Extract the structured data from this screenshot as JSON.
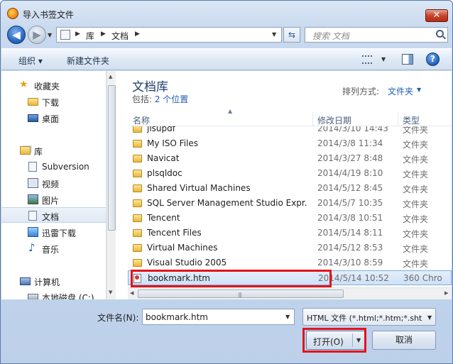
{
  "window": {
    "title": "导入书签文件",
    "close_label": "✕"
  },
  "navbar": {
    "breadcrumb": [
      "库",
      "文档"
    ],
    "search_placeholder": "搜索 文档"
  },
  "toolbar": {
    "organize_label": "组织 ▾",
    "new_folder_label": "新建文件夹",
    "help_label": "?"
  },
  "sidebar": {
    "items": [
      {
        "label": "收藏夹",
        "icon": "star-icon"
      },
      {
        "label": "下载",
        "icon": "folder-icon"
      },
      {
        "label": "桌面",
        "icon": "desktop-icon"
      },
      {
        "label": "库",
        "icon": "library-icon"
      },
      {
        "label": "Subversion",
        "icon": "document-icon"
      },
      {
        "label": "视频",
        "icon": "video-icon"
      },
      {
        "label": "图片",
        "icon": "picture-icon"
      },
      {
        "label": "文档",
        "icon": "document-icon"
      },
      {
        "label": "迅雷下载",
        "icon": "download-icon"
      },
      {
        "label": "音乐",
        "icon": "music-icon"
      },
      {
        "label": "计算机",
        "icon": "computer-icon"
      },
      {
        "label": "本地磁盘 (C:)",
        "icon": "disk-icon"
      }
    ],
    "selected": "文档"
  },
  "library": {
    "title": "文档库",
    "includes_label": "包括: ",
    "includes_link": "2 个位置",
    "arrange_label": "排列方式:",
    "arrange_value": "文件夹"
  },
  "columns": {
    "name": "名称",
    "date": "修改日期",
    "type": "类型"
  },
  "files": [
    {
      "name": "jisupdf",
      "date": "2014/3/10 14:43",
      "type": "文件夹"
    },
    {
      "name": "My ISO Files",
      "date": "2014/3/8 11:34",
      "type": "文件夹"
    },
    {
      "name": "Navicat",
      "date": "2014/3/27 8:48",
      "type": "文件夹"
    },
    {
      "name": "plsqldoc",
      "date": "2014/4/19 8:10",
      "type": "文件夹"
    },
    {
      "name": "Shared Virtual Machines",
      "date": "2014/5/12 8:45",
      "type": "文件夹"
    },
    {
      "name": "SQL Server Management Studio Expr...",
      "date": "2014/5/7 10:35",
      "type": "文件夹"
    },
    {
      "name": "Tencent",
      "date": "2014/3/8 10:51",
      "type": "文件夹"
    },
    {
      "name": "Tencent Files",
      "date": "2014/5/14 8:11",
      "type": "文件夹"
    },
    {
      "name": "Virtual Machines",
      "date": "2014/5/12 8:53",
      "type": "文件夹"
    },
    {
      "name": "Visual Studio 2005",
      "date": "2014/3/10 8:59",
      "type": "文件夹"
    },
    {
      "name": "bookmark.htm",
      "date": "2014/5/14 10:52",
      "type": "360 Chro"
    }
  ],
  "bottom": {
    "filename_label": "文件名(N):",
    "filename_value": "bookmark.htm",
    "filetype_value": "HTML 文件 (*.html;*.htm;*.sht",
    "open_label": "打开(O)",
    "cancel_label": "取消"
  },
  "colors": {
    "highlight": "#e3141b",
    "link": "#1d5db8"
  }
}
